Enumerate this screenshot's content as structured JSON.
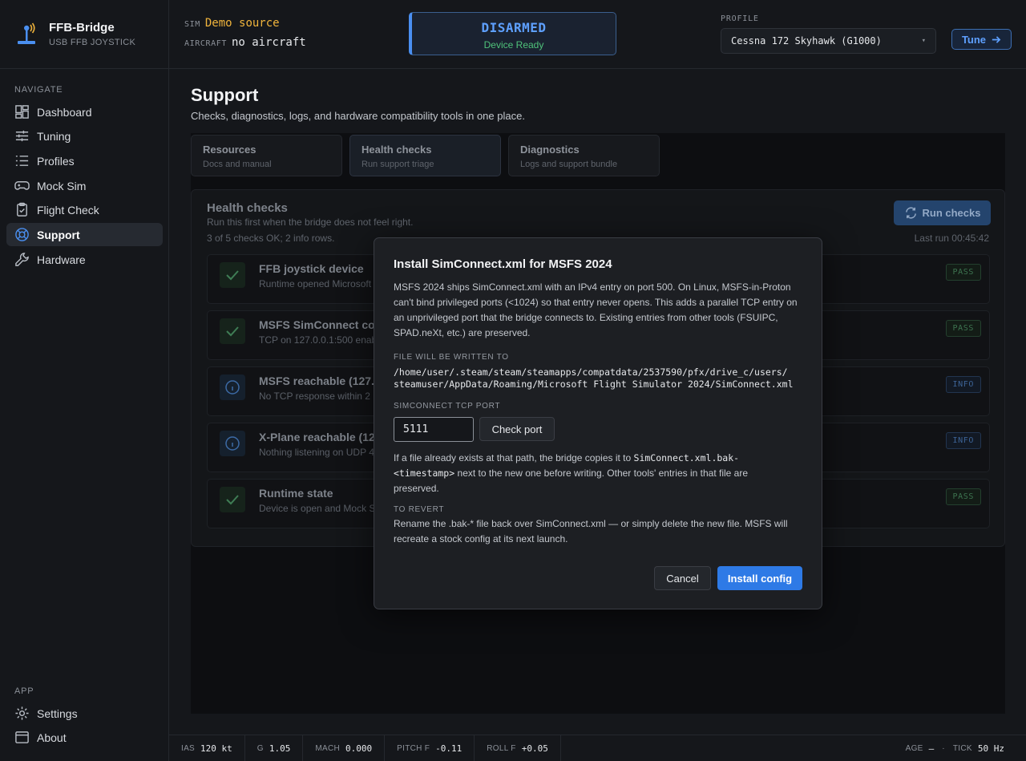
{
  "brand": {
    "title": "FFB-Bridge",
    "subtitle": "USB FFB JOYSTICK"
  },
  "header": {
    "sim_key": "SIM",
    "sim_value": "Demo source",
    "aircraft_key": "AIRCRAFT",
    "aircraft_value": "no aircraft",
    "arm_state": "DISARMED",
    "arm_sub": "Device Ready",
    "profile_label": "PROFILE",
    "profile_value": "Cessna 172 Skyhawk (G1000)",
    "tune_label": "Tune"
  },
  "sidebar": {
    "nav_label": "NAVIGATE",
    "items": [
      {
        "label": "Dashboard",
        "icon": "dashboard-icon"
      },
      {
        "label": "Tuning",
        "icon": "sliders-icon"
      },
      {
        "label": "Profiles",
        "icon": "list-icon"
      },
      {
        "label": "Mock Sim",
        "icon": "gamepad-icon"
      },
      {
        "label": "Flight Check",
        "icon": "clipboard-check-icon"
      },
      {
        "label": "Support",
        "icon": "lifebuoy-icon",
        "active": true
      },
      {
        "label": "Hardware",
        "icon": "wrench-icon"
      }
    ],
    "app_label": "APP",
    "app_items": [
      {
        "label": "Settings",
        "icon": "gear-icon"
      },
      {
        "label": "About",
        "icon": "window-icon"
      }
    ]
  },
  "page": {
    "title": "Support",
    "subtitle": "Checks, diagnostics, logs, and hardware compatibility tools in one place."
  },
  "tabs": [
    {
      "title": "Resources",
      "sub": "Docs and manual"
    },
    {
      "title": "Health checks",
      "sub": "Run support triage",
      "active": true
    },
    {
      "title": "Diagnostics",
      "sub": "Logs and support bundle"
    }
  ],
  "health": {
    "title": "Health checks",
    "subtitle": "Run this first when the bridge does not feel right.",
    "count": "3 of 5 checks OK; 2 info rows.",
    "run_label": "Run checks",
    "last_run": "Last run 00:45:42",
    "checks": [
      {
        "name": "FFB joystick device",
        "desc": "Runtime opened Microsoft",
        "status": "PASS"
      },
      {
        "name": "MSFS SimConnect con",
        "desc": "TCP on 127.0.0.1:500 enabl",
        "status": "PASS"
      },
      {
        "name": "MSFS reachable (127.0.",
        "desc": "No TCP response within 2",
        "status": "INFO"
      },
      {
        "name": "X-Plane reachable (127",
        "desc": "Nothing listening on UDP 4",
        "status": "INFO"
      },
      {
        "name": "Runtime state",
        "desc": "Device is open and Mock S",
        "status": "PASS"
      }
    ]
  },
  "modal": {
    "title": "Install SimConnect.xml for MSFS 2024",
    "intro": "MSFS 2024 ships SimConnect.xml with an IPv4 entry on port 500. On Linux, MSFS-in-Proton can't bind privileged ports (<1024) so that entry never opens. This adds a parallel TCP entry on an unprivileged port that the bridge connects to. Existing entries from other tools (FSUIPC, SPAD.neXt, etc.) are preserved.",
    "path_label": "FILE WILL BE WRITTEN TO",
    "path_line1": "/home/user/.steam/steam/steamapps/compatdata/2537590/pfx/drive_c/users/",
    "path_line2": "steamuser/AppData/Roaming/Microsoft Flight Simulator 2024/SimConnect.xml",
    "port_label": "SIMCONNECT TCP PORT",
    "port_value": "5111",
    "check_port_label": "Check port",
    "backup_pre": "If a file already exists at that path, the bridge copies it to",
    "backup_code1": "SimConnect.xml.bak-",
    "backup_code2": "<timestamp>",
    "backup_post": "next to the new one before writing. Other tools' entries in that file are",
    "backup_end": "preserved.",
    "revert_label": "TO REVERT",
    "revert_text": "Rename the .bak-* file back over SimConnect.xml — or simply delete the new file. MSFS will recreate a stock config at its next launch.",
    "cancel_label": "Cancel",
    "install_label": "Install config"
  },
  "statusbar": {
    "items": [
      {
        "key": "IAS",
        "value": "120 kt"
      },
      {
        "key": "G",
        "value": "1.05"
      },
      {
        "key": "MACH",
        "value": "0.000"
      },
      {
        "key": "PITCH F",
        "value": "-0.11"
      },
      {
        "key": "ROLL F",
        "value": "+0.05"
      }
    ],
    "age_key": "AGE",
    "age_value": "—",
    "sep": "·",
    "tick_key": "TICK",
    "tick_value": "50 Hz"
  },
  "colors": {
    "accent": "#2e7ae6",
    "armed_text": "#5ea0ff",
    "ready": "#4fc27a",
    "sim_value": "#f0b43c"
  }
}
